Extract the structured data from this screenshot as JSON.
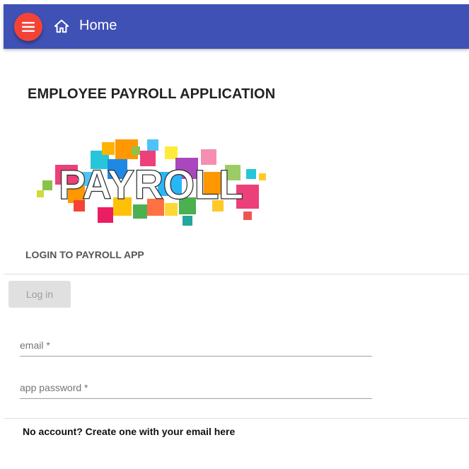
{
  "appbar": {
    "home_label": "Home",
    "color": "#3f51b5",
    "menu_color": "#f44336"
  },
  "page": {
    "title": "EMPLOYEE PAYROLL APPLICATION"
  },
  "logo": {
    "text": "PAYROLL"
  },
  "login": {
    "heading": "LOGIN TO PAYROLL APP",
    "button_label": "Log in",
    "email_placeholder": "email *",
    "password_placeholder": "app password *",
    "email_value": "",
    "password_value": ""
  },
  "footer": {
    "signup_text": "No account? Create one with your email here"
  }
}
